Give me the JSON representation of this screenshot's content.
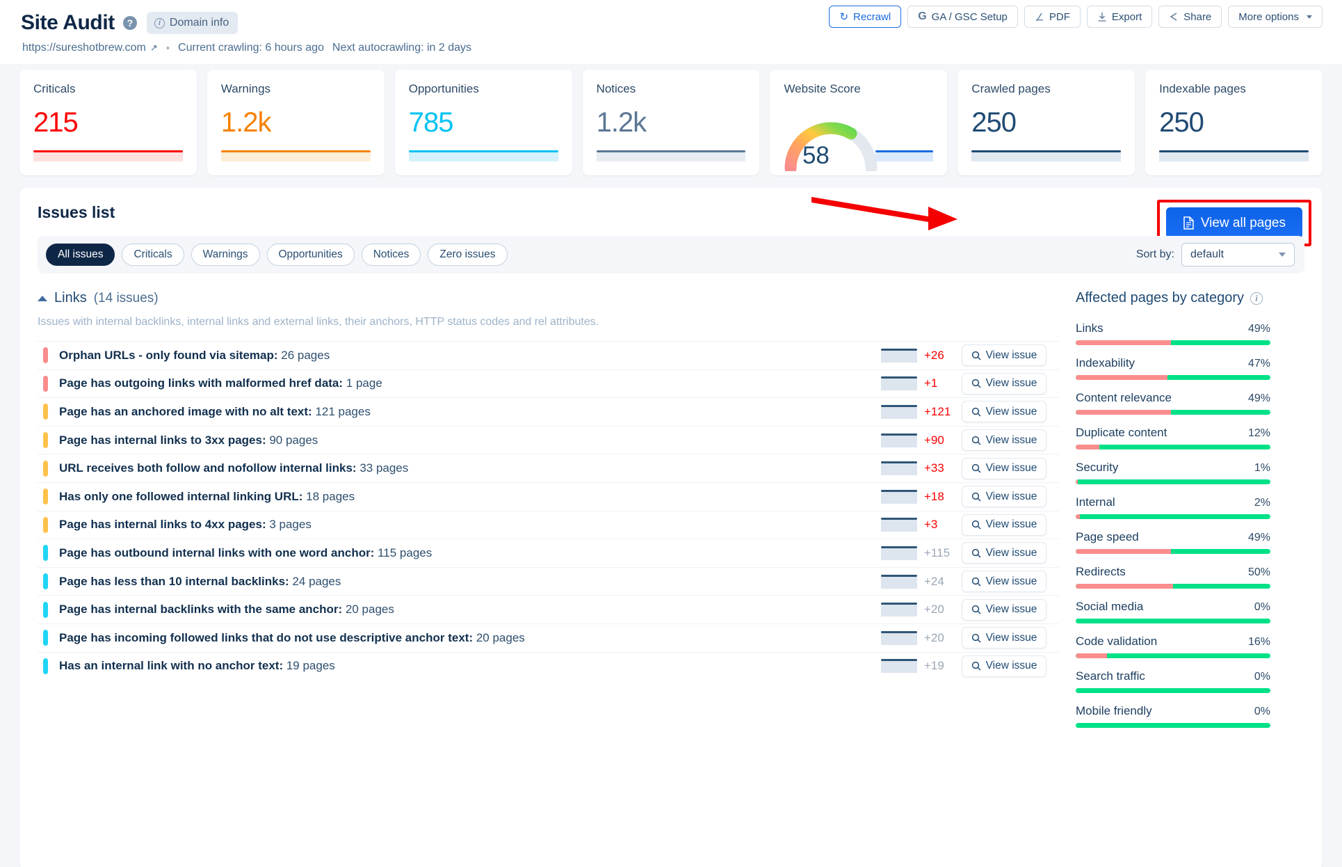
{
  "header": {
    "title": "Site Audit",
    "help_icon": "question-mark-icon",
    "domain_info_label": "Domain info",
    "actions": [
      {
        "label": "Recrawl",
        "icon": "refresh-icon",
        "style": "primary-outline"
      },
      {
        "label": "GA / GSC Setup",
        "icon": "google-icon",
        "style": "default"
      },
      {
        "label": "PDF",
        "icon": "pdf-icon",
        "style": "default"
      },
      {
        "label": "Export",
        "icon": "download-icon",
        "style": "default"
      },
      {
        "label": "Share",
        "icon": "share-icon",
        "style": "default"
      },
      {
        "label": "More options",
        "icon": "chevron-down-icon",
        "style": "default"
      }
    ],
    "url": "https://sureshotbrew.com",
    "external_link_icon": "external-link-icon",
    "separator": "•",
    "current_crawling": "Current crawling: 6 hours ago",
    "next_autocrawling": "Next autocrawling: in 2 days"
  },
  "cards": [
    {
      "label": "Criticals",
      "value": "215",
      "color": "#fb0202",
      "fill": "#fde0e0"
    },
    {
      "label": "Warnings",
      "value": "1.2k",
      "color": "#f68100",
      "fill": "#fdeed7"
    },
    {
      "label": "Opportunities",
      "value": "785",
      "color": "#00c2f3",
      "fill": "#d4f2fb"
    },
    {
      "label": "Notices",
      "value": "1.2k",
      "color": "#5b7794",
      "fill": "#e7edf3"
    },
    {
      "label": "Website Score",
      "value": "58",
      "color": "#1a6be0",
      "fill": "#dbe9fc",
      "gauge": 58
    },
    {
      "label": "Crawled pages",
      "value": "250",
      "color": "#1f4a73",
      "fill": "#e0e8f0"
    },
    {
      "label": "Indexable pages",
      "value": "250",
      "color": "#1f4a73",
      "fill": "#e0e8f0"
    }
  ],
  "issues_panel": {
    "title": "Issues list",
    "view_all_label": "View all pages",
    "view_all_icon": "document-icon",
    "filters": [
      {
        "label": "All issues",
        "active": true
      },
      {
        "label": "Criticals",
        "active": false
      },
      {
        "label": "Warnings",
        "active": false
      },
      {
        "label": "Opportunities",
        "active": false
      },
      {
        "label": "Notices",
        "active": false
      },
      {
        "label": "Zero issues",
        "active": false
      }
    ],
    "sort_label": "Sort by:",
    "sort_value": "default",
    "section": {
      "name": "Links",
      "count": "(14 issues)",
      "description": "Issues with internal backlinks, internal links and external links, their anchors, HTTP status codes and rel attributes."
    },
    "view_issue_label": "View issue",
    "view_issue_icon": "magnifier-icon",
    "rows": [
      {
        "name": "Orphan URLs - only found via sitemap:",
        "count": "26 pages",
        "severity": "#fb8d8d",
        "delta": "+26",
        "delta_state": "up"
      },
      {
        "name": "Page has outgoing links with malformed href data:",
        "count": "1 page",
        "severity": "#fb8d8d",
        "delta": "+1",
        "delta_state": "up"
      },
      {
        "name": "Page has an anchored image with no alt text:",
        "count": "121 pages",
        "severity": "#ffc24d",
        "delta": "+121",
        "delta_state": "up"
      },
      {
        "name": "Page has internal links to 3xx pages:",
        "count": "90 pages",
        "severity": "#ffc24d",
        "delta": "+90",
        "delta_state": "up"
      },
      {
        "name": "URL receives both follow and nofollow internal links:",
        "count": "33 pages",
        "severity": "#ffc24d",
        "delta": "+33",
        "delta_state": "up"
      },
      {
        "name": "Has only one followed internal linking URL:",
        "count": "18 pages",
        "severity": "#ffc24d",
        "delta": "+18",
        "delta_state": "up"
      },
      {
        "name": "Page has internal links to 4xx pages:",
        "count": "3 pages",
        "severity": "#ffc24d",
        "delta": "+3",
        "delta_state": "up"
      },
      {
        "name": "Page has outbound internal links with one word anchor:",
        "count": "115 pages",
        "severity": "#20d5f5",
        "delta": "+115",
        "delta_state": "flat"
      },
      {
        "name": "Page has less than 10 internal backlinks:",
        "count": "24 pages",
        "severity": "#20d5f5",
        "delta": "+24",
        "delta_state": "flat"
      },
      {
        "name": "Page has internal backlinks with the same anchor:",
        "count": "20 pages",
        "severity": "#20d5f5",
        "delta": "+20",
        "delta_state": "flat"
      },
      {
        "name": "Page has incoming followed links that do not use descriptive anchor text:",
        "count": "20 pages",
        "severity": "#20d5f5",
        "delta": "+20",
        "delta_state": "flat"
      },
      {
        "name": "Has an internal link with no anchor text:",
        "count": "19 pages",
        "severity": "#20d5f5",
        "delta": "+19",
        "delta_state": "flat"
      }
    ]
  },
  "affected_pages": {
    "title": "Affected pages by category",
    "info_icon": "info-icon",
    "items": [
      {
        "name": "Links",
        "percent": "49%",
        "value": 49
      },
      {
        "name": "Indexability",
        "percent": "47%",
        "value": 47
      },
      {
        "name": "Content relevance",
        "percent": "49%",
        "value": 49
      },
      {
        "name": "Duplicate content",
        "percent": "12%",
        "value": 12
      },
      {
        "name": "Security",
        "percent": "1%",
        "value": 1
      },
      {
        "name": "Internal",
        "percent": "2%",
        "value": 2
      },
      {
        "name": "Page speed",
        "percent": "49%",
        "value": 49
      },
      {
        "name": "Redirects",
        "percent": "50%",
        "value": 50
      },
      {
        "name": "Social media",
        "percent": "0%",
        "value": 0
      },
      {
        "name": "Code validation",
        "percent": "16%",
        "value": 16
      },
      {
        "name": "Search traffic",
        "percent": "0%",
        "value": 0
      },
      {
        "name": "Mobile friendly",
        "percent": "0%",
        "value": 0
      }
    ],
    "bar_red": "#fb8d8d",
    "bar_green": "#00e187"
  },
  "annotation": {
    "arrow_color": "#f50000",
    "highlight_color": "#f50000"
  }
}
